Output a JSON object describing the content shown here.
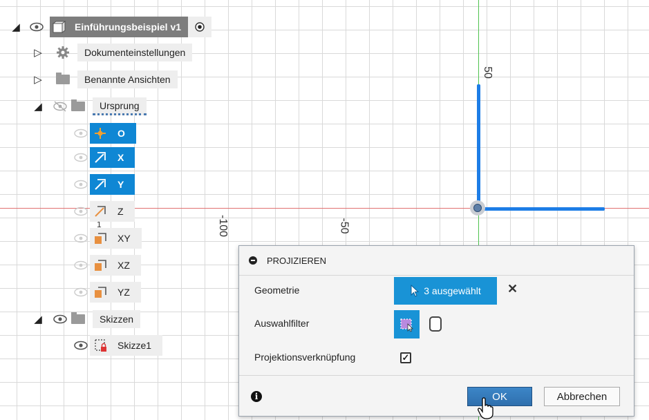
{
  "browser": {
    "root": {
      "label": "Einführungsbeispiel v1"
    },
    "items": [
      {
        "label": "Dokumenteinstellungen"
      },
      {
        "label": "Benannte Ansichten"
      },
      {
        "label": "Ursprung"
      },
      {
        "label": "O"
      },
      {
        "label": "X"
      },
      {
        "label": "Y"
      },
      {
        "label": "Z"
      },
      {
        "label": "XY"
      },
      {
        "label": "XZ"
      },
      {
        "label": "YZ"
      },
      {
        "label": "Skizzen"
      },
      {
        "label": "Skizze1"
      }
    ]
  },
  "canvas": {
    "ticks": {
      "y_50": "50",
      "x_neg100": "-100",
      "x_neg50": "-50",
      "small_one": "1"
    },
    "colors": {
      "x_axis": "#e07070",
      "y_axis": "#4fc24f",
      "selection": "#1d7de6"
    }
  },
  "dialog": {
    "title": "PROJIZIEREN",
    "geometry_label": "Geometrie",
    "selection_value": "3 ausgewählt",
    "filter_label": "Auswahlfilter",
    "link_label": "Projektionsverknüpfung",
    "link_checked": true,
    "ok_label": "OK",
    "cancel_label": "Abbrechen",
    "accent": "#1993d6"
  }
}
